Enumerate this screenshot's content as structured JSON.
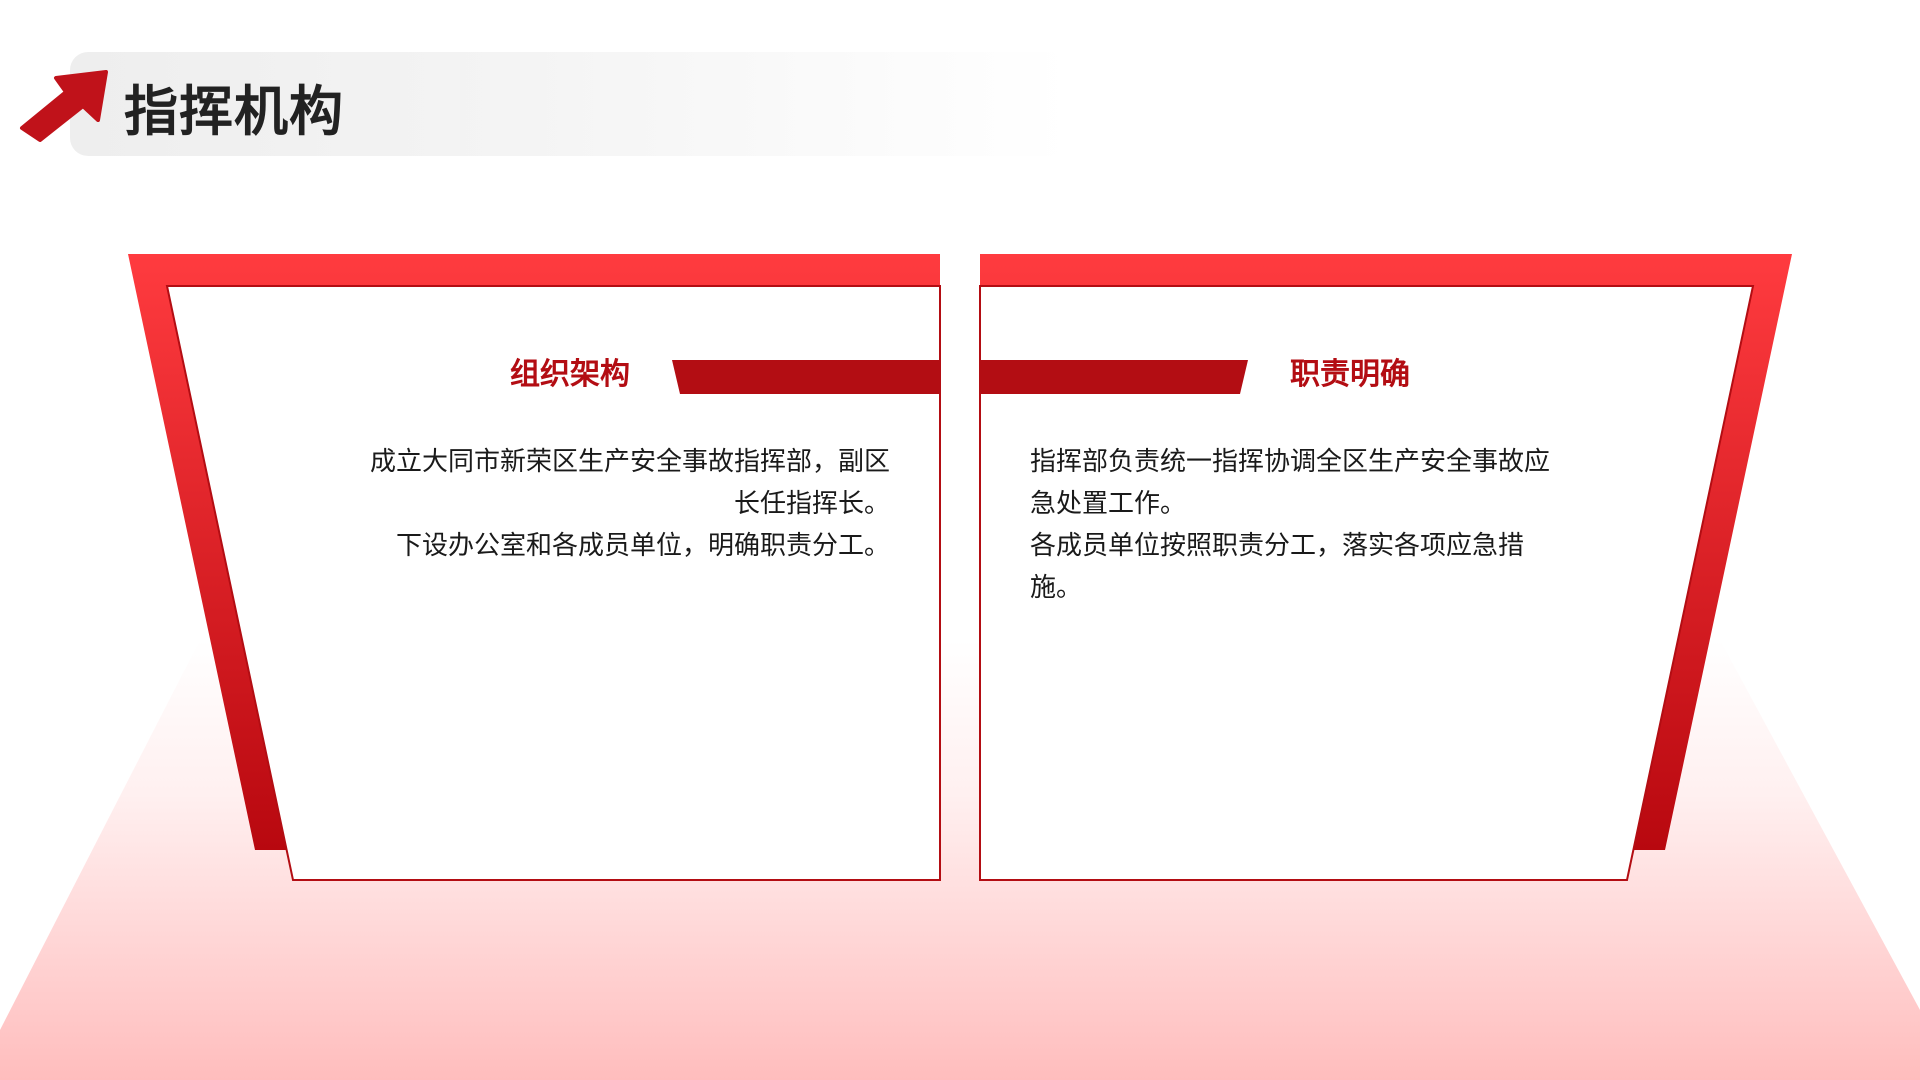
{
  "slide": {
    "title": "指挥机构",
    "accent_color": "#b30d13",
    "bright_red": "#ff3b3f",
    "arrow_icon": "arrow-up-right-icon"
  },
  "cards": [
    {
      "heading": "组织架构",
      "body_lines": [
        "成立大同市新荣区生产安全事故指挥部，副区",
        "长任指挥长。",
        "下设办公室和各成员单位，明确职责分工。"
      ]
    },
    {
      "heading": "职责明确",
      "body_lines": [
        "指挥部负责统一指挥协调全区生产安全事故应",
        "急处置工作。",
        "各成员单位按照职责分工，落实各项应急措",
        "施。"
      ]
    }
  ]
}
